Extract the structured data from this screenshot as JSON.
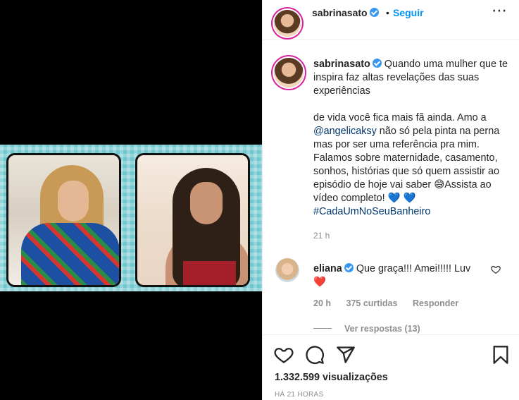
{
  "header": {
    "username": "sabrinasato",
    "separator": "•",
    "follow_label": "Seguir",
    "more_label": "•••"
  },
  "caption": {
    "username": "sabrinasato",
    "line1": "Quando uma mulher que te inspira faz altas revelações das suas experiências",
    "line2_pre": "de vida você fica mais fã ainda. Amo a ",
    "mention": "@angelicaksy",
    "line2_post": " não só pela pinta na perna mas por ser uma referência pra mim. Falamos sobre maternidade, casamento, sonhos, histórias que só quem assistir ao episódio de hoje vai saber 😅Assista ao vídeo completo! ",
    "heart1": "💙",
    "heart2": "💙",
    "hashtag": "#CadaUmNoSeuBanheiro",
    "time": "21 h"
  },
  "comment": {
    "username": "eliana",
    "text": "Que graça!!! Amei!!!!! Luv ",
    "heart": "❤️",
    "time": "20 h",
    "likes": "375 curtidas",
    "reply_label": "Responder",
    "view_replies": "Ver respostas (13)"
  },
  "footer": {
    "views": "1.332.599 visualizações",
    "posted_ago": "HÁ 21 HORAS"
  },
  "icons": {
    "like": "heart-icon",
    "comment": "comment-icon",
    "share": "share-icon",
    "save": "bookmark-icon"
  },
  "colors": {
    "link": "#0095f6",
    "hashtag": "#00376b",
    "verified": "#3897f0",
    "secondary_text": "#8e8e8e"
  }
}
